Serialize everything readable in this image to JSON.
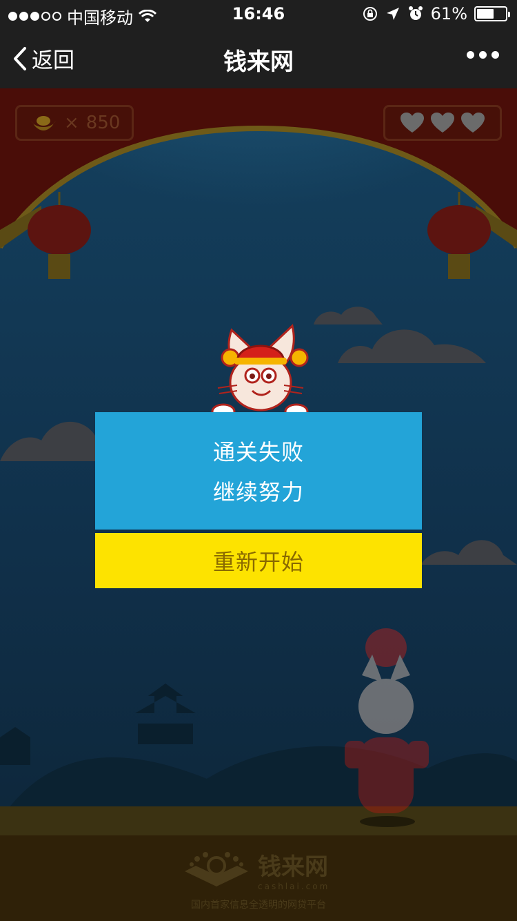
{
  "status_bar": {
    "carrier": "中国移动",
    "time": "16:46",
    "battery_percent": "61%",
    "battery_level": 0.61
  },
  "nav": {
    "back_label": "返回",
    "title": "钱来网"
  },
  "hud": {
    "coin_multiplier": "×",
    "coins": "850",
    "lives": 3
  },
  "dialog": {
    "line1": "通关失败",
    "line2": "继续努力",
    "restart_label": "重新开始"
  },
  "footer": {
    "brand_name": "钱来网",
    "brand_domain": "cashlai.com",
    "slogan": "国内首家信息全透明的网贷平台"
  },
  "colors": {
    "dialog_blue": "#23a4d8",
    "restart_yellow": "#fde300",
    "curtain_red": "#4a0d08"
  }
}
